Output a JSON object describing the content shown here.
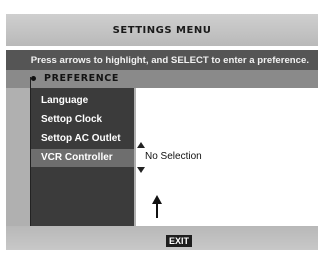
{
  "menu": {
    "title": "SETTINGS MENU",
    "instruction": "Press arrows to highlight, and SELECT to enter a preference.",
    "section_label": "PREFERENCE"
  },
  "preferences": {
    "items": [
      {
        "label": "Language",
        "selected": false
      },
      {
        "label": "Settop Clock",
        "selected": false
      },
      {
        "label": "Settop AC Outlet",
        "selected": false
      },
      {
        "label": "VCR Controller",
        "selected": true
      }
    ],
    "selected_value": "No Selection"
  },
  "footer": {
    "exit_label": "EXIT"
  },
  "icons": {
    "up": "arrow-up-icon",
    "down": "arrow-down-icon",
    "pointer": "pointer-arrow-icon"
  }
}
